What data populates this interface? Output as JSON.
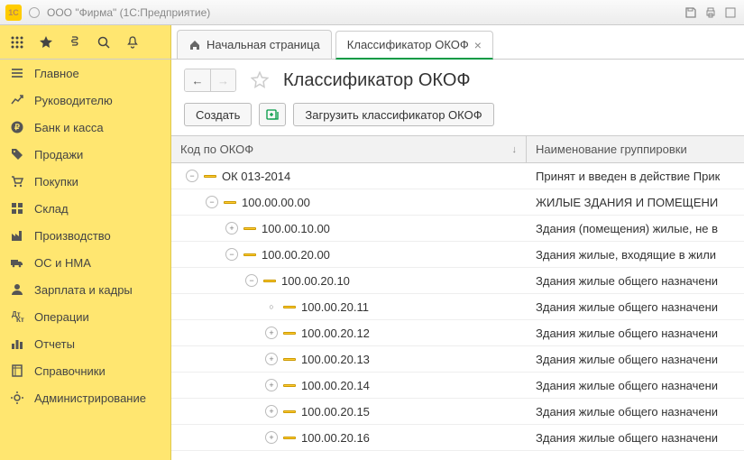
{
  "window": {
    "title": "ООО \"Фирма\"  (1С:Предприятие)",
    "logo": "1C"
  },
  "tabs": {
    "home": "Начальная страница",
    "active": "Классификатор ОКОФ"
  },
  "sidebar": [
    {
      "icon": "menu",
      "label": "Главное"
    },
    {
      "icon": "trend",
      "label": "Руководителю"
    },
    {
      "icon": "ruble",
      "label": "Банк и касса"
    },
    {
      "icon": "tag",
      "label": "Продажи"
    },
    {
      "icon": "cart",
      "label": "Покупки"
    },
    {
      "icon": "boxes",
      "label": "Склад"
    },
    {
      "icon": "factory",
      "label": "Производство"
    },
    {
      "icon": "truck",
      "label": "ОС и НМА"
    },
    {
      "icon": "person",
      "label": "Зарплата и кадры"
    },
    {
      "icon": "ops",
      "label": "Операции"
    },
    {
      "icon": "bars",
      "label": "Отчеты"
    },
    {
      "icon": "book",
      "label": "Справочники"
    },
    {
      "icon": "admin",
      "label": "Администрирование"
    }
  ],
  "page": {
    "title": "Классификатор ОКОФ",
    "create": "Создать",
    "load": "Загрузить классификатор ОКОФ"
  },
  "table": {
    "col_code": "Код по ОКОФ",
    "col_name": "Наименование группировки",
    "rows": [
      {
        "depth": 0,
        "exp": "-",
        "code": "ОК 013-2014",
        "name": "Принят и введен в действие Прик"
      },
      {
        "depth": 1,
        "exp": "-",
        "code": "100.00.00.00",
        "name": "ЖИЛЫЕ ЗДАНИЯ И ПОМЕЩЕНИ"
      },
      {
        "depth": 2,
        "exp": "+",
        "code": "100.00.10.00",
        "name": "Здания (помещения) жилые, не в"
      },
      {
        "depth": 2,
        "exp": "-",
        "code": "100.00.20.00",
        "name": "Здания жилые, входящие в жили"
      },
      {
        "depth": 3,
        "exp": "-",
        "code": "100.00.20.10",
        "name": "Здания жилые общего назначени"
      },
      {
        "depth": 4,
        "exp": "o",
        "code": "100.00.20.11",
        "name": "Здания жилые общего назначени"
      },
      {
        "depth": 4,
        "exp": "+",
        "code": "100.00.20.12",
        "name": "Здания жилые общего назначени"
      },
      {
        "depth": 4,
        "exp": "+",
        "code": "100.00.20.13",
        "name": "Здания жилые общего назначени"
      },
      {
        "depth": 4,
        "exp": "+",
        "code": "100.00.20.14",
        "name": "Здания жилые общего назначени"
      },
      {
        "depth": 4,
        "exp": "+",
        "code": "100.00.20.15",
        "name": "Здания жилые общего назначени"
      },
      {
        "depth": 4,
        "exp": "+",
        "code": "100.00.20.16",
        "name": "Здания жилые общего назначени"
      }
    ]
  }
}
